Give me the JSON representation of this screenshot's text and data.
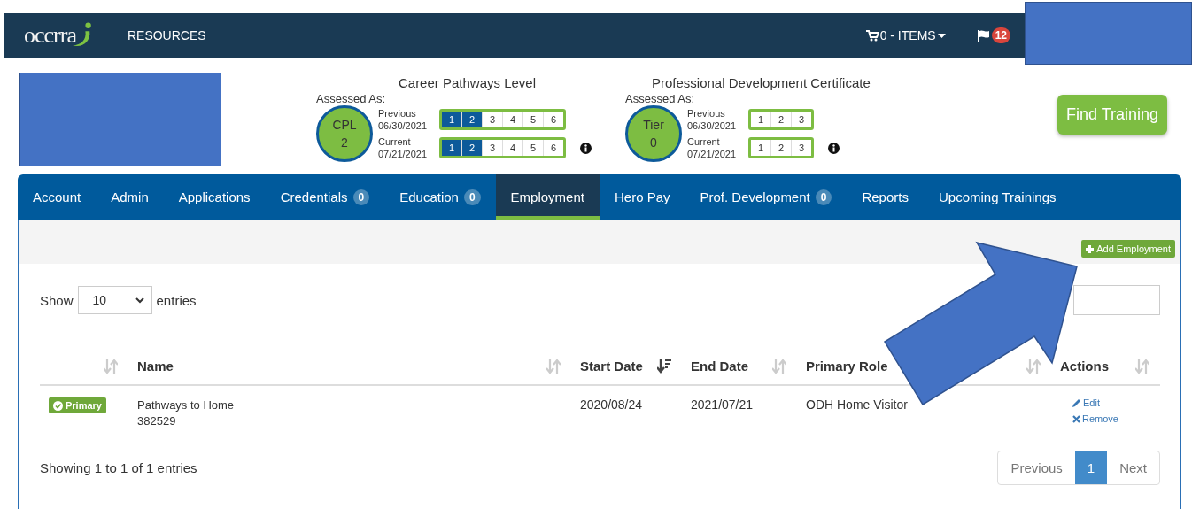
{
  "navbar": {
    "logo": "occrra",
    "links": [
      "RESOURCES"
    ],
    "cart": "0 - ITEMS",
    "notifications": "12"
  },
  "assessments": [
    {
      "title": "Career Pathways Level",
      "assessed_label": "Assessed As:",
      "badge": [
        "CPL",
        "2"
      ],
      "rows": [
        {
          "label": "Previous",
          "date": "06/30/2021",
          "levels": [
            {
              "label": "1",
              "selected": true
            },
            {
              "label": "2",
              "selected": true
            },
            {
              "label": "3",
              "selected": false
            },
            {
              "label": "4",
              "selected": false
            },
            {
              "label": "5",
              "selected": false
            },
            {
              "label": "6",
              "selected": false
            }
          ]
        },
        {
          "label": "Current",
          "date": "07/21/2021",
          "levels": [
            {
              "label": "1",
              "selected": true
            },
            {
              "label": "2",
              "selected": true
            },
            {
              "label": "3",
              "selected": false
            },
            {
              "label": "4",
              "selected": false
            },
            {
              "label": "5",
              "selected": false
            },
            {
              "label": "6",
              "selected": false
            }
          ]
        }
      ]
    },
    {
      "title": "Professional Development Certificate",
      "assessed_label": "Assessed As:",
      "badge": [
        "Tier",
        "0"
      ],
      "rows": [
        {
          "label": "Previous",
          "date": "06/30/2021",
          "levels": [
            {
              "label": "1",
              "selected": false
            },
            {
              "label": "2",
              "selected": false
            },
            {
              "label": "3",
              "selected": false
            }
          ]
        },
        {
          "label": "Current",
          "date": "07/21/2021",
          "levels": [
            {
              "label": "1",
              "selected": false
            },
            {
              "label": "2",
              "selected": false
            },
            {
              "label": "3",
              "selected": false
            }
          ]
        }
      ]
    }
  ],
  "find_training_button": "Find Training",
  "tabs": [
    {
      "label": "Account",
      "selected": false
    },
    {
      "label": "Admin",
      "selected": false
    },
    {
      "label": "Applications",
      "selected": false
    },
    {
      "label": "Credentials",
      "count": "0",
      "selected": false
    },
    {
      "label": "Education",
      "count": "0",
      "selected": false
    },
    {
      "label": "Employment",
      "selected": true
    },
    {
      "label": "Hero Pay",
      "selected": false
    },
    {
      "label": "Prof. Development",
      "count": "0",
      "selected": false
    },
    {
      "label": "Reports",
      "selected": false
    },
    {
      "label": "Upcoming Trainings",
      "selected": false
    }
  ],
  "add_button": "Add Employment",
  "length_menu": {
    "before": "Show",
    "value": "10",
    "after": "entries"
  },
  "table": {
    "columns": [
      {
        "sorted": false
      },
      {
        "label": "Name",
        "sorted": false
      },
      {
        "label": "Start Date",
        "sorted": true
      },
      {
        "label": "End Date",
        "sorted": false
      },
      {
        "label": "Primary Role",
        "sorted": false
      },
      {
        "label": "Actions",
        "sorted": false
      }
    ],
    "rows": [
      {
        "badge": "Primary",
        "name": "Pathways to Home",
        "id": "382529",
        "start": "2020/08/24",
        "end": "2021/07/21",
        "role": "ODH Home Visitor",
        "actions": [
          {
            "kind": "edit",
            "label": "Edit"
          },
          {
            "kind": "remove",
            "label": "Remove"
          }
        ]
      }
    ]
  },
  "info": "Showing 1 to 1 of 1 entries",
  "pagination": [
    {
      "label": "Previous",
      "selected": false
    },
    {
      "label": "1",
      "selected": true
    },
    {
      "label": "Next",
      "selected": false
    }
  ]
}
